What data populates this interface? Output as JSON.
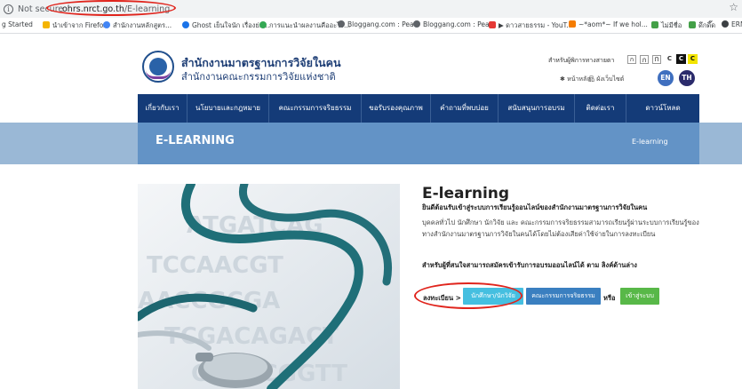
{
  "browser": {
    "info_icon": "i",
    "not_secure": "Not secure",
    "url_domain": "ohrs.nrct.go.th",
    "url_path": "/E-learning",
    "star_icon": "☆",
    "bookmarks": [
      {
        "label": "g Started",
        "color": "#ffffff"
      },
      {
        "label": "นำเข้าจาก Firefox",
        "color": "#f4b400"
      },
      {
        "label": "สำนักงานหลักสูตร...",
        "color": "#4285f4"
      },
      {
        "label": "Ghost เย็นใจนัก เรื่องย่อ...",
        "color": "#1a73e8"
      },
      {
        "label": "การแนะนำผลงานคืออะไร...",
        "color": "#34a853"
      },
      {
        "label": "Bloggang.com : Pea...",
        "color": "#5f6368"
      },
      {
        "label": "Bloggang.com : Pea...",
        "color": "#5f6368"
      },
      {
        "label": "▶ ดาวสายธรรม - YouT...",
        "color": "#e53935"
      },
      {
        "label": "~*aom*~ If we hol...",
        "color": "#f57c00"
      },
      {
        "label": "ไม่มีชื่อ",
        "color": "#43a047"
      },
      {
        "label": "ดึกดึ๊ด",
        "color": "#43a047"
      },
      {
        "label": "ERM",
        "color": "#3c4043"
      }
    ]
  },
  "header": {
    "title_line1": "สำนักงานมาตรฐานการวิจัยในคน",
    "title_line2": "สำนักงานคณะกรรมการวิจัยแห่งชาติ",
    "staff_link": "สำหรับผู้พิการทางสายตา",
    "font_sizes": [
      "ก",
      "ก",
      "ก"
    ],
    "contrast": [
      "C",
      "C",
      "C"
    ],
    "home_link": "✱ หน้าหลัก",
    "sitemap_link": "ผังเว็บไซต์",
    "lang_en": "EN",
    "lang_th": "TH"
  },
  "nav": {
    "items": [
      "เกี่ยวกับเรา",
      "นโยบายและกฎหมาย",
      "คณะกรรมการจริยธรรม",
      "ขอรับรองคุณภาพ",
      "คำถามที่พบบ่อย",
      "สนับสนุนการอบรม",
      "ติดต่อเรา",
      "ดาวน์โหลด"
    ]
  },
  "band": {
    "title": "E-LEARNING",
    "crumb": "E-learning"
  },
  "content": {
    "heading": "E-learning",
    "welcome": "ยินดีต้อนรับเข้าสู่ระบบการเรียนรู้ออนไลน์ของสำนักงานมาตรฐานการวิจัยในคน",
    "description": "บุคคลทั่วไป นักศึกษา นักวิจัย และ คณะกรรมการจริยธรรมสามารถเรียนรู้ผ่านระบบการเรียนรู้ของทางสำนักงานมาตรฐานการวิจัยในคนได้โดยไม่ต้องเสียค่าใช้จ่ายในการลงทะเบียน",
    "apply_note": "สำหรับผู้ที่สนใจสามารถสมัครเข้ารับการอบรมออนไลน์ได้ ตาม ลิงค์ด้านล่าง",
    "register_label": "ลงทะเบียน >",
    "btn_student": "นักศึกษา/นักวิจัย",
    "btn_committee": "คณะกรรมการจริยธรรม",
    "or_label": "หรือ",
    "btn_login": "เข้าสู่ระบบ"
  },
  "colors": {
    "nav_bg": "#143b78",
    "band_inner": "#6393c6",
    "band_outer": "#9ab8d6",
    "btn_student": "#45bfe0",
    "btn_committee": "#3a7fc0",
    "btn_login": "#58b848",
    "annotation": "#e0241c"
  }
}
